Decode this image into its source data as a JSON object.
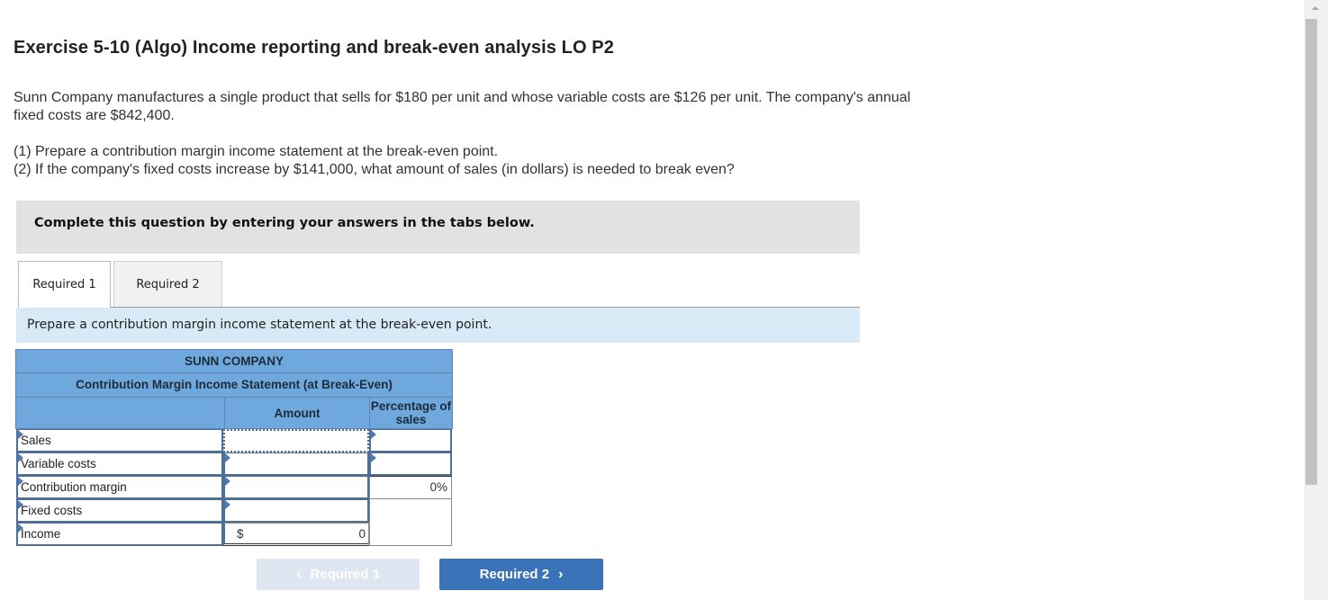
{
  "header": {
    "title": "Exercise 5-10 (Algo) Income reporting and break-even analysis LO P2"
  },
  "problem": {
    "intro": "Sunn Company manufactures a single product that sells for $180 per unit and whose variable costs are $126 per unit. The company's annual fixed costs are $842,400.",
    "req1": "(1) Prepare a contribution margin income statement at the break-even point.",
    "req2": "(2) If the company's fixed costs increase by $141,000, what amount of sales (in dollars) is needed to break even?"
  },
  "instructions": "Complete this question by entering your answers in the tabs below.",
  "tabs": [
    {
      "label": "Required 1",
      "active": true
    },
    {
      "label": "Required 2",
      "active": false
    }
  ],
  "prompt": "Prepare a contribution margin income statement at the break-even point.",
  "statement": {
    "company": "SUNN COMPANY",
    "title": "Contribution Margin Income Statement (at Break-Even)",
    "columns": {
      "amount": "Amount",
      "percentage": "Percentage of sales"
    },
    "rows": [
      {
        "label": "Sales",
        "amount": "",
        "percentage": ""
      },
      {
        "label": "Variable costs",
        "amount": "",
        "percentage": ""
      },
      {
        "label": "Contribution margin",
        "amount": "",
        "percentage": "0%"
      },
      {
        "label": "Fixed costs",
        "amount": ""
      },
      {
        "label": "Income",
        "currency": "$",
        "amount": "0"
      }
    ]
  },
  "nav": {
    "prev_label": "Required 1",
    "next_label": "Required 2",
    "prev_icon": "chevron-left-icon",
    "next_icon": "chevron-right-icon"
  },
  "colors": {
    "table_header": "#6fa8dc",
    "prompt_bg": "#d9eaf7",
    "next_button": "#3a73b8",
    "prev_button_disabled": "#dde6f1"
  }
}
